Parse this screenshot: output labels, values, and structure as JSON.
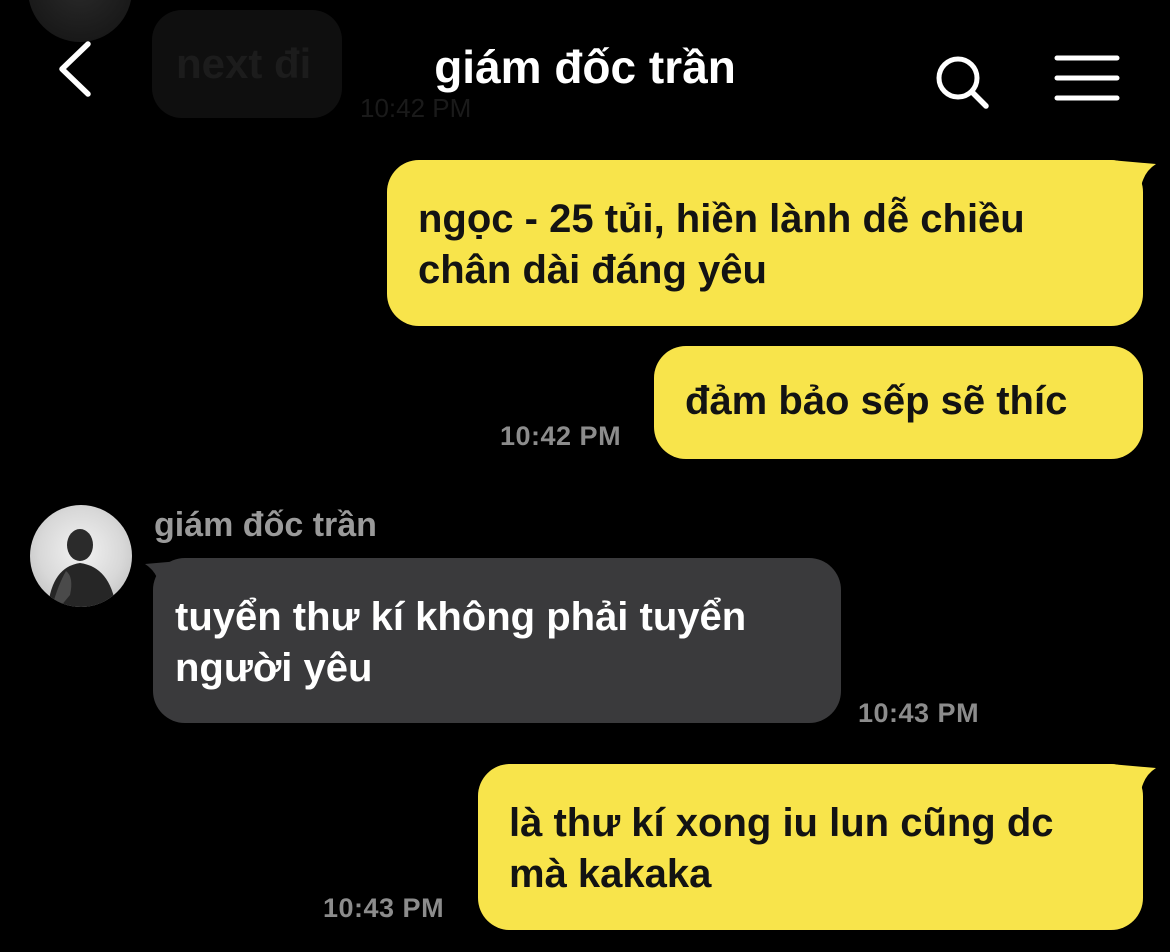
{
  "previous": {
    "text": "next đi",
    "time": "10:42 PM"
  },
  "header": {
    "title": "giám đốc trần",
    "back_icon": "chevron-left-icon",
    "search_icon": "search-icon",
    "menu_icon": "hamburger-menu-icon"
  },
  "colors": {
    "my_bubble": "#F8E44B",
    "their_bubble": "#3A3A3C",
    "background": "#000000",
    "timestamp": "#8C8C8C"
  },
  "messages": [
    {
      "sender": "me",
      "lines": [
        "ngọc - 25 tủi, hiền lành dễ chiều",
        "chân dài đáng yêu"
      ]
    },
    {
      "sender": "me",
      "lines": [
        "đảm bảo sếp sẽ thíc"
      ],
      "time": "10:42 PM"
    },
    {
      "sender": "them",
      "name": "giám đốc trần",
      "lines": [
        "tuyển thư kí không phải tuyển",
        "người yêu"
      ],
      "time": "10:43 PM"
    },
    {
      "sender": "me",
      "lines": [
        "là thư kí xong iu lun cũng dc",
        "mà kakaka"
      ],
      "time": "10:43 PM"
    }
  ]
}
